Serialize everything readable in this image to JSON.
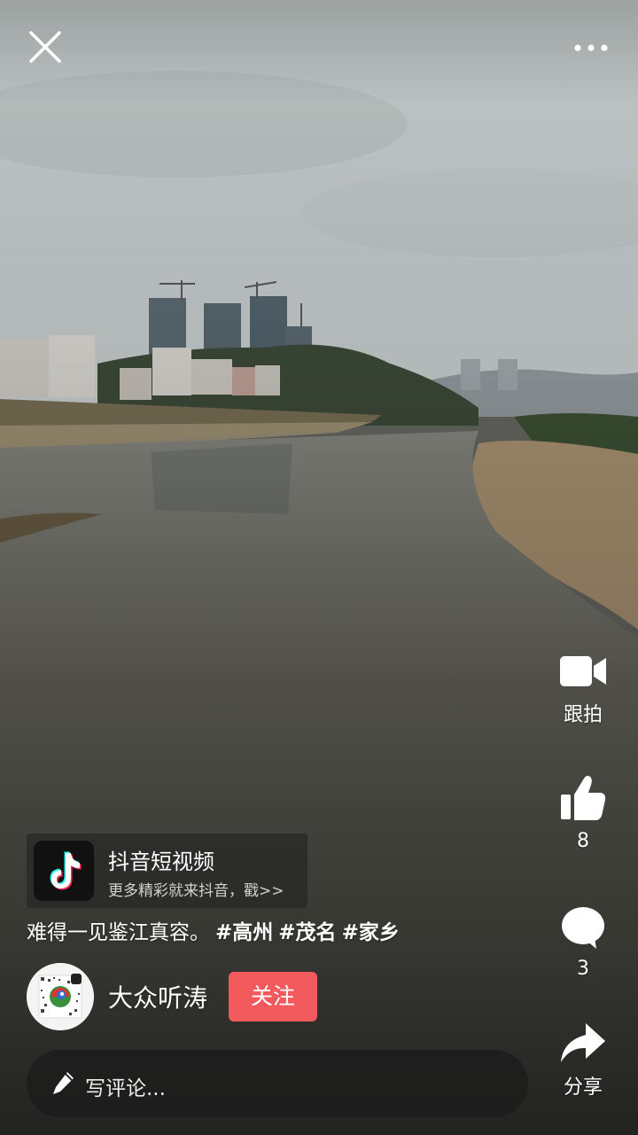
{
  "topbar": {
    "close_icon": "close-icon",
    "more_icon": "more-dots-icon"
  },
  "actions": {
    "duet": {
      "icon": "video-camera-icon",
      "label": "跟拍"
    },
    "like": {
      "icon": "thumbs-up-icon",
      "count": "8"
    },
    "comment": {
      "icon": "speech-bubble-icon",
      "count": "3"
    },
    "share": {
      "icon": "share-arrow-icon",
      "label": "分享"
    }
  },
  "app_banner": {
    "name": "抖音短视频",
    "slogan": "更多精彩就来抖音，戳>>",
    "logo_icon": "douyin-logo-icon"
  },
  "caption": {
    "text": "难得一见鉴江真容。",
    "hashtags": [
      "#高州",
      "#茂名",
      "#家乡"
    ]
  },
  "author": {
    "name": "大众听涛",
    "follow_label": "关注",
    "avatar_icon": "avatar-logo-icon"
  },
  "comment_input": {
    "placeholder": "写评论...",
    "icon": "pencil-icon"
  },
  "colors": {
    "follow_button": "#f25a5d",
    "text": "#ffffff"
  }
}
